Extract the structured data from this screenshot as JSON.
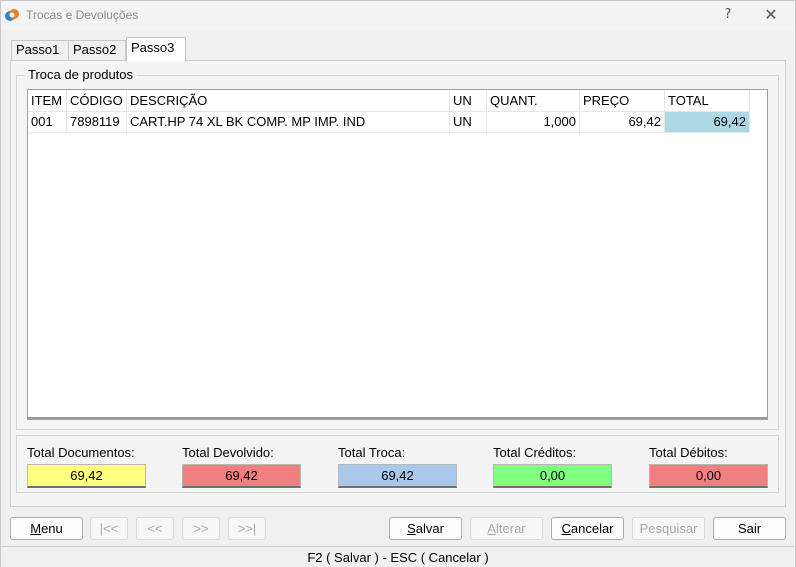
{
  "window": {
    "title": "Trocas e Devoluções",
    "help_label": "?",
    "close_label": "✕"
  },
  "tabs": [
    {
      "label": "Passo1",
      "active": false
    },
    {
      "label": "Passo2",
      "active": false
    },
    {
      "label": "Passo3",
      "active": true
    }
  ],
  "group": {
    "legend": "Troca de produtos"
  },
  "grid": {
    "columns": [
      "ITEM",
      "CÓDIGO",
      "DESCRIÇÃO",
      "UN",
      "QUANT.",
      "PREÇO",
      "TOTAL"
    ],
    "rows": [
      {
        "item": "001",
        "codigo": "7898119",
        "descricao": "CART.HP 74 XL BK COMP. MP IMP. IND",
        "un": "UN",
        "quant": "1,000",
        "preco": "69,42",
        "total": "69,42"
      }
    ],
    "total_cell_color": "#add8e6"
  },
  "totals": [
    {
      "label": "Total Documentos:",
      "value": "69,42",
      "color": "#ffff80"
    },
    {
      "label": "Total Devolvido:",
      "value": "69,42",
      "color": "#f08080"
    },
    {
      "label": "Total Troca:",
      "value": "69,42",
      "color": "#a9c8ec"
    },
    {
      "label": "Total Créditos:",
      "value": "0,00",
      "color": "#80ff80"
    },
    {
      "label": "Total Débitos:",
      "value": "0,00",
      "color": "#f08080"
    }
  ],
  "buttons": {
    "menu": {
      "first": "M",
      "rest": "enu"
    },
    "first_record": "|<<",
    "prev_record": "<<",
    "next_record": ">>",
    "last_record": ">>|",
    "salvar": {
      "first": "S",
      "rest": "alvar"
    },
    "alterar": {
      "first": "A",
      "rest": "lterar"
    },
    "cancelar": {
      "first": "C",
      "rest": "ancelar"
    },
    "pesquisar": "Pesquisar",
    "sair": "Sair"
  },
  "statusbar": {
    "text": "F2 ( Salvar )  -  ESC ( Cancelar )"
  }
}
